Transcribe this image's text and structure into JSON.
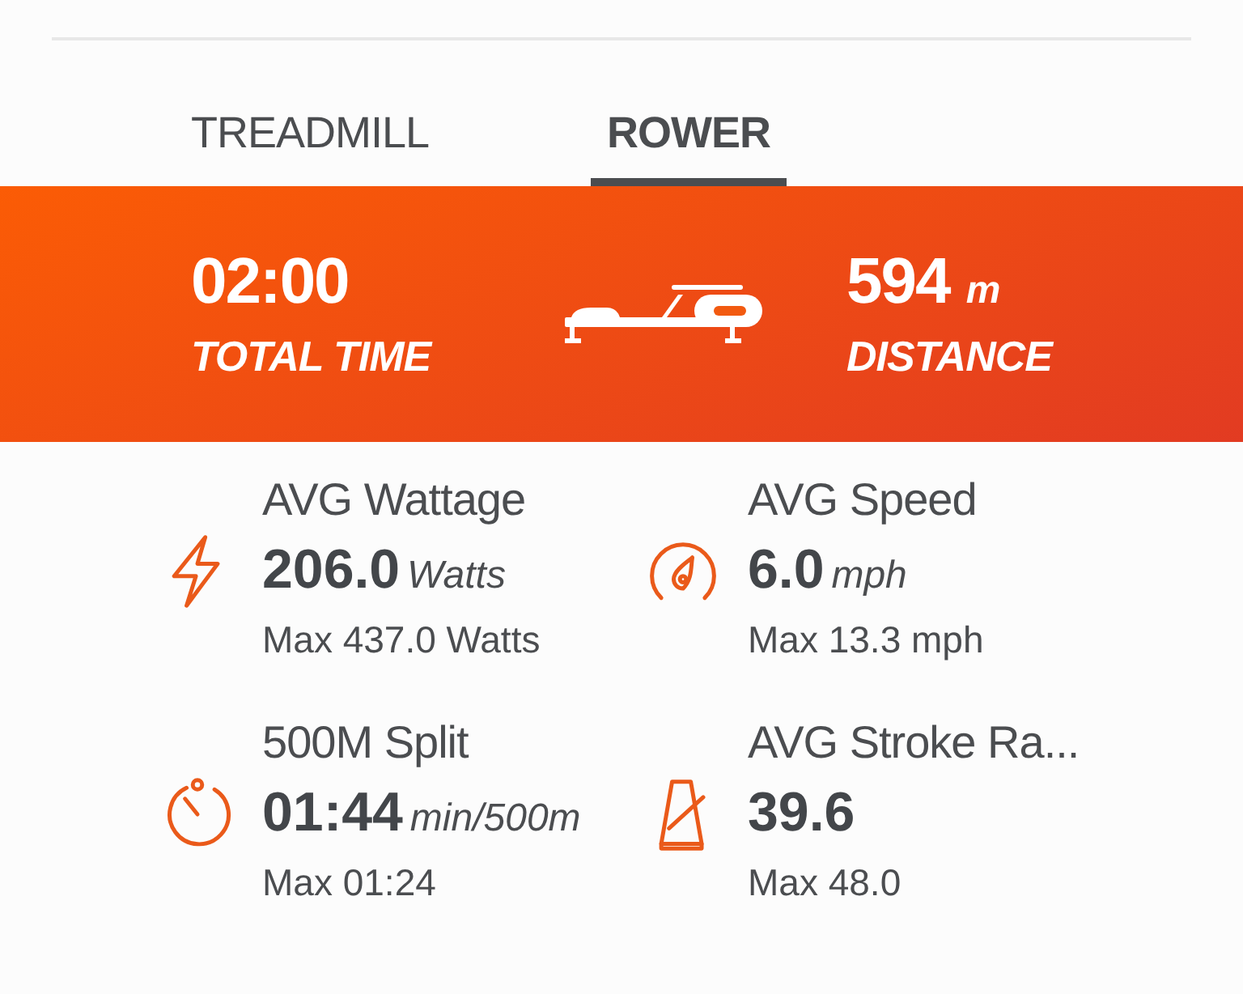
{
  "tabs": [
    {
      "label": "TREADMILL",
      "selected": false
    },
    {
      "label": "ROWER",
      "selected": true
    }
  ],
  "summary": {
    "time": {
      "value": "02:00",
      "label": "TOTAL TIME"
    },
    "distance": {
      "value": "594",
      "unit": "m",
      "label": "DISTANCE"
    }
  },
  "metrics": [
    {
      "kind": "bolt",
      "title": "AVG Wattage",
      "value": "206.0",
      "unit": "Watts",
      "max": "Max 437.0 Watts"
    },
    {
      "kind": "gauge",
      "title": "AVG Speed",
      "value": "6.0",
      "unit": "mph",
      "max": "Max 13.3 mph"
    },
    {
      "kind": "timer",
      "title": "500M Split",
      "value": "01:44",
      "unit": "min/500m",
      "max": "Max 01:24"
    },
    {
      "kind": "metronome",
      "title": "AVG Stroke Ra...",
      "value": "39.6",
      "max": "Max 48.0"
    }
  ]
}
